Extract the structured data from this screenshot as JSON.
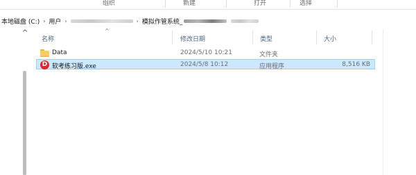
{
  "ribbon": {
    "groups": [
      "组织",
      "新建",
      "打开",
      "选择"
    ]
  },
  "address": {
    "segments": [
      "本地磁盘 (C:)",
      "用户",
      "模拟作管系统_"
    ]
  },
  "columns": {
    "name": "名称",
    "date": "修改日期",
    "type": "类型",
    "size": "大小"
  },
  "files": [
    {
      "name": "Data",
      "date": "2024/5/10 10:21",
      "type": "文件夹",
      "size": "",
      "icon": "folder-icon",
      "selected": false
    },
    {
      "name": "软考练习版.exe",
      "date": "2024/5/8 10:12",
      "type": "应用程序",
      "size": "8,516 KB",
      "icon": "app-icon",
      "selected": true
    }
  ],
  "app_icon_glyph": "D",
  "colors": {
    "selection_bg": "#cce8ff",
    "selection_border": "#99d1ff",
    "folder_yellow": "#f8cf5c",
    "app_icon_red": "#e8232e",
    "header_text": "#4d6480"
  }
}
